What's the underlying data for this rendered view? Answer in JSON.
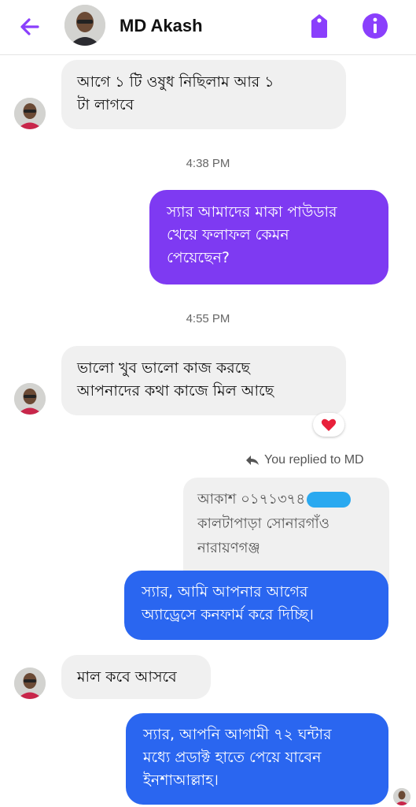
{
  "header": {
    "contact_name": "MD Akash",
    "back_icon": "arrow-left-icon",
    "tag_icon": "tag-icon",
    "info_icon": "info-icon",
    "accent": "#8a3ffc"
  },
  "messages": {
    "m1_line1": "আগে ১ টি ওষুধ নিছিলাম  আর ১",
    "m1_line2": "টা লাগবে",
    "time1": "4:38 PM",
    "m2_line1": "স্যার আমাদের মাকা পাউডার",
    "m2_line2": "খেয়ে ফলাফল কেমন",
    "m2_line3": "পেয়েছেন?",
    "time2": "4:55 PM",
    "m3_line1": "ভালো খুব ভালো কাজ করছে",
    "m3_line2": "আপনাদের কথা কাজে মিল আছে",
    "m3_reaction": "heart",
    "reply_label": "You replied to MD",
    "quoted_line1": "আকাশ ০১৭১৩৭৪",
    "quoted_line2": "কালটাপাড়া সোনারগাঁও",
    "quoted_line3": "নারায়ণগঞ্জ",
    "m4_line1": "স্যার, আমি আপনার আগের",
    "m4_line2": "অ্যাড্রেসে কনফার্ম করে দিচ্ছি।",
    "m5_line1": "মাল কবে আসবে",
    "m6_line1": "স্যার, আপনি আগামী ৭২ ঘন্টার",
    "m6_line2": "মধ্যে প্রডাক্ট হাতে পেয়ে যাবেন",
    "m6_line3": "ইনশাআল্লাহ।"
  },
  "colors": {
    "purple_bubble": "#7e3af2",
    "blue_bubble": "#2a66f0",
    "incoming_bubble": "#f0f0f0"
  }
}
